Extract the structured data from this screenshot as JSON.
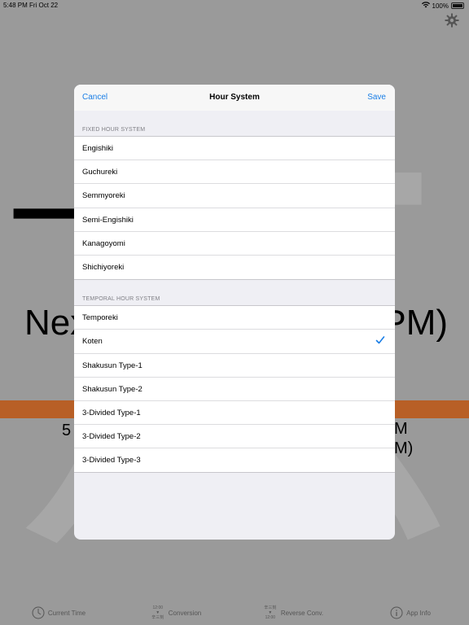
{
  "status_bar": {
    "time": "5:48 PM",
    "date": "Fri Oct 22",
    "battery": "100%",
    "icons": [
      "wifi-icon",
      "battery-icon"
    ]
  },
  "background": {
    "big_kanji": "一点",
    "next_left": "Nex",
    "next_right": "PM)",
    "time_left": "5",
    "time_right_1": "M",
    "time_right_2": "M)",
    "band_color": "#b85f26",
    "settings_icon": "gear-icon"
  },
  "modal": {
    "cancel": "Cancel",
    "title": "Hour System",
    "save": "Save",
    "accent_color": "#1a7ee6",
    "sections": [
      {
        "header": "FIXED HOUR SYSTEM",
        "items": [
          "Engishiki",
          "Guchureki",
          "Semmyoreki",
          "Semi-Engishiki",
          "Kanagoyomi",
          "Shichiyoreki"
        ]
      },
      {
        "header": "TEMPORAL HOUR SYSTEM",
        "items": [
          "Temporeki",
          "Koten",
          "Shakusun Type-1",
          "Shakusun Type-2",
          "3-Divided Type-1",
          "3-Divided Type-2",
          "3-Divided Type-3"
        ]
      }
    ],
    "selected": "Koten"
  },
  "tab_bar": {
    "tabs": [
      {
        "label": "Current Time",
        "icon": "clock-icon"
      },
      {
        "label": "Conversion",
        "icon": "conversion-icon",
        "icon_top": "12:00",
        "icon_bottom": "辛三刻"
      },
      {
        "label": "Reverse Conv.",
        "icon": "reverse-conversion-icon",
        "icon_top": "辛三刻",
        "icon_bottom": "12:00"
      },
      {
        "label": "App Info",
        "icon": "info-icon"
      }
    ]
  }
}
